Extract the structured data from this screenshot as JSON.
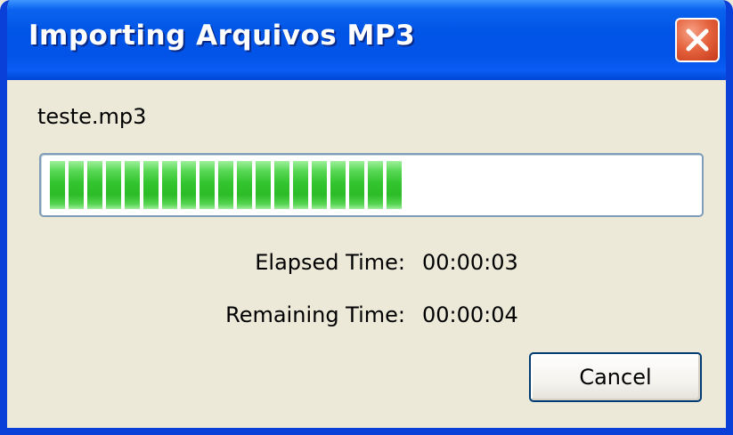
{
  "window": {
    "title": "Importing Arquivos MP3",
    "close_icon": "close-icon"
  },
  "file": {
    "name": "teste.mp3"
  },
  "progress": {
    "fraction": 0.57,
    "filled_blocks": 19,
    "total_blocks": 33,
    "color": "#33c530"
  },
  "times": {
    "elapsed_label": "Elapsed Time:",
    "elapsed_value": "00:00:03",
    "remaining_label": "Remaining Time:",
    "remaining_value": "00:00:04"
  },
  "buttons": {
    "cancel_label": "Cancel"
  },
  "colors": {
    "titlebar": "#0155e6",
    "dialog_bg": "#ece9d8",
    "close_button": "#e6653f"
  }
}
